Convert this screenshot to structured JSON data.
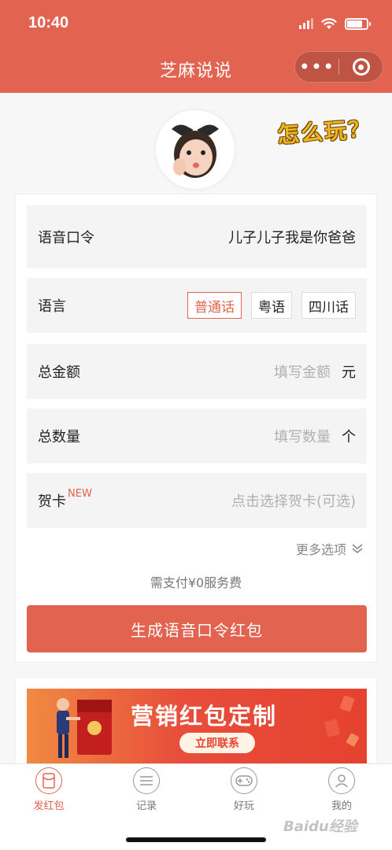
{
  "status_bar": {
    "time": "10:40"
  },
  "nav": {
    "title": "芝麻说说",
    "more_icon": "more-dots-icon",
    "close_icon": "target-circle-icon"
  },
  "help_text": "怎么玩？",
  "form": {
    "voice_command": {
      "label": "语音口令",
      "value": "儿子儿子我是你爸爸"
    },
    "language": {
      "label": "语言",
      "options": [
        "普通话",
        "粤语",
        "四川话"
      ],
      "selected": "普通话"
    },
    "total_amount": {
      "label": "总金额",
      "placeholder": "填写金额",
      "unit": "元"
    },
    "total_count": {
      "label": "总数量",
      "placeholder": "填写数量",
      "unit": "个"
    },
    "card": {
      "label": "贺卡",
      "badge": "NEW",
      "placeholder": "点击选择贺卡(可选)"
    },
    "more_options": "更多选项",
    "fee_text": "需支付¥0服务费",
    "submit_label": "生成语音口令红包"
  },
  "banner": {
    "title": "营销红包定制",
    "button": "立即联系"
  },
  "tabbar": {
    "items": [
      {
        "label": "发红包",
        "icon": "red-packet-icon",
        "active": true
      },
      {
        "label": "记录",
        "icon": "list-icon",
        "active": false
      },
      {
        "label": "好玩",
        "icon": "gamepad-icon",
        "active": false
      },
      {
        "label": "我的",
        "icon": "user-icon",
        "active": false
      }
    ]
  },
  "watermark": "Baidu经验",
  "colors": {
    "brand": "#e16350",
    "help_yellow": "#f2b522"
  }
}
